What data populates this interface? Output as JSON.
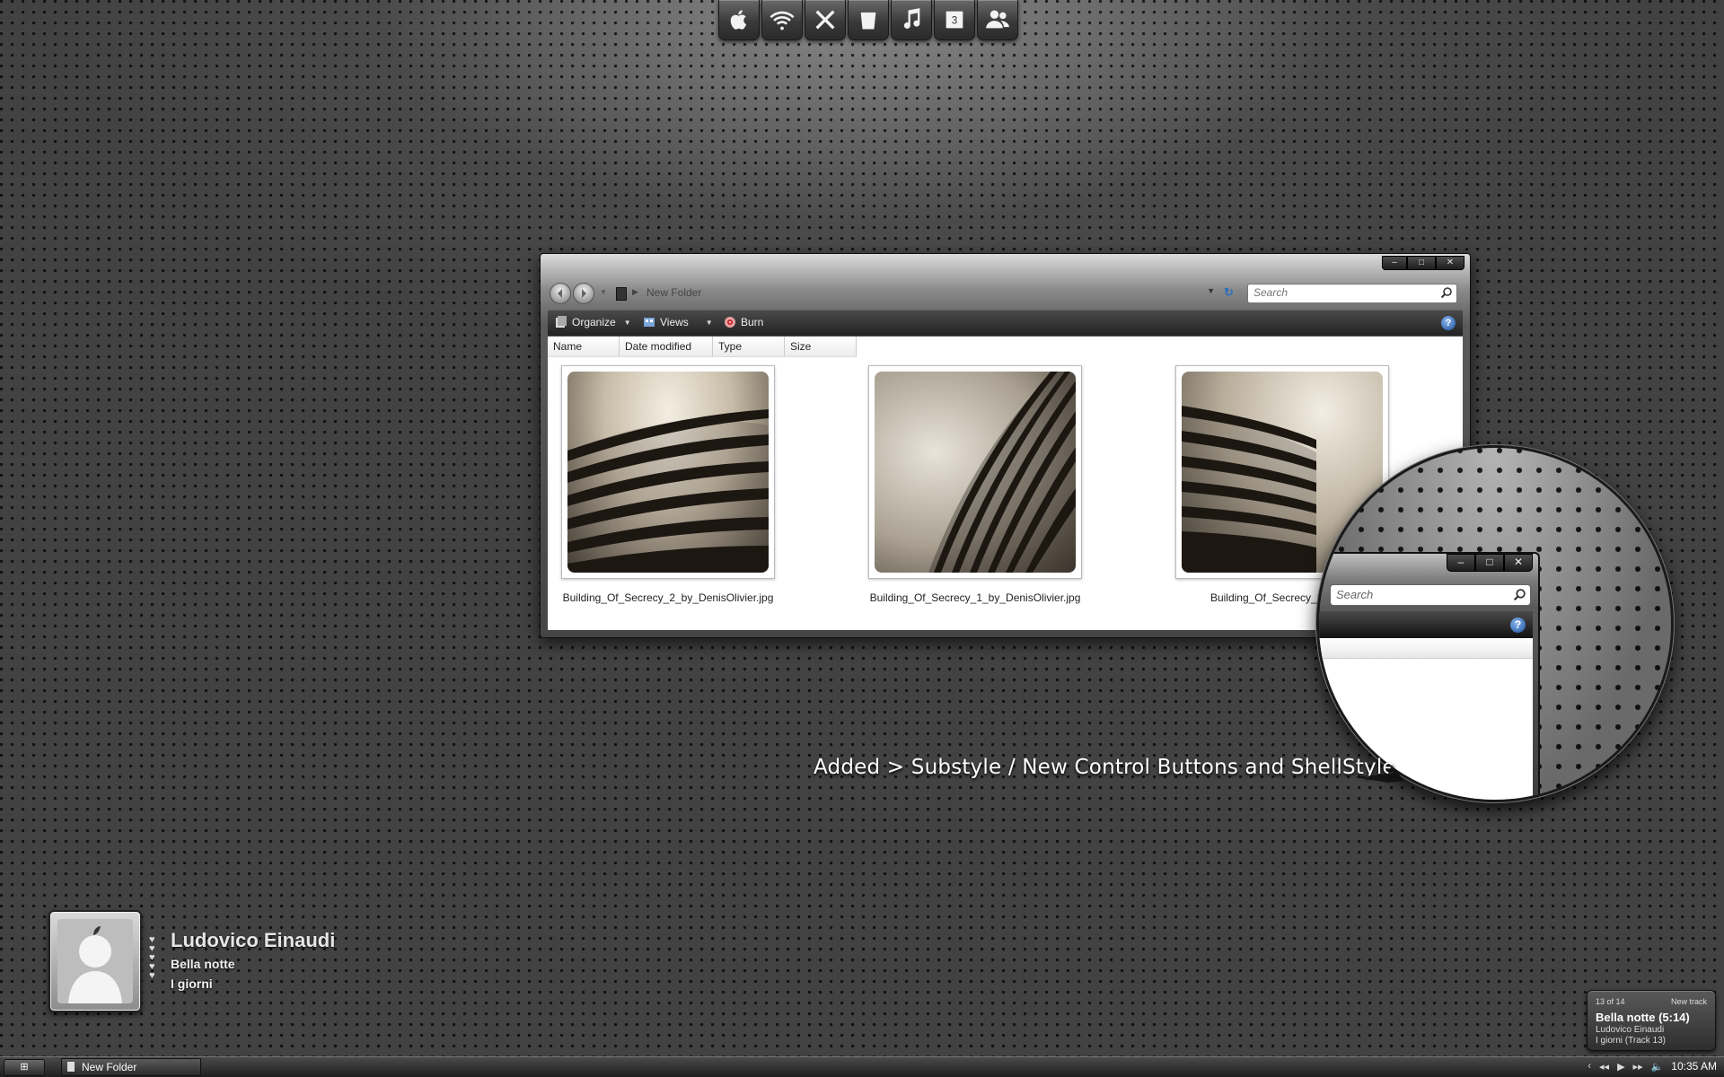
{
  "dock": {
    "items": [
      {
        "name": "apple-icon",
        "label": "Apple"
      },
      {
        "name": "wifi-icon",
        "label": "Network"
      },
      {
        "name": "tools-icon",
        "label": "Tools"
      },
      {
        "name": "trash-icon",
        "label": "Recycle Bin"
      },
      {
        "name": "music-icon",
        "label": "Music"
      },
      {
        "name": "calendar-icon",
        "label": "3"
      },
      {
        "name": "users-icon",
        "label": "Users"
      }
    ]
  },
  "explorer": {
    "window_buttons": [
      "–",
      "□",
      "✕"
    ],
    "breadcrumb": "New Folder",
    "search_placeholder": "Search",
    "toolbar": {
      "organize": "Organize",
      "views": "Views",
      "burn": "Burn",
      "help": "?"
    },
    "columns": [
      "Name",
      "Date modified",
      "Type",
      "Size"
    ],
    "files": [
      {
        "name": "Building_Of_Secrecy_2_by_DenisOlivier.jpg"
      },
      {
        "name": "Building_Of_Secrecy_1_by_DenisOlivier.jpg"
      },
      {
        "name": "Building_Of_Secrecy_3_by_D"
      }
    ]
  },
  "magnifier": {
    "search_placeholder": "Search",
    "window_buttons": [
      "–",
      "□",
      "✕"
    ],
    "help": "?"
  },
  "caption": "Added > Substyle / New Control Buttons and ShellStyle",
  "now_playing": {
    "artist": "Ludovico Einaudi",
    "title": "Bella notte",
    "album": "I giorni",
    "hearts": "♥"
  },
  "toast": {
    "position": "13 of 14",
    "status": "New track",
    "track": "Bella notte (5:14)",
    "artist": "Ludovico Einaudi",
    "album": "I giorni (Track 13)"
  },
  "taskbar": {
    "start": "⊞",
    "task": "New Folder",
    "clock": "10:35 AM"
  }
}
